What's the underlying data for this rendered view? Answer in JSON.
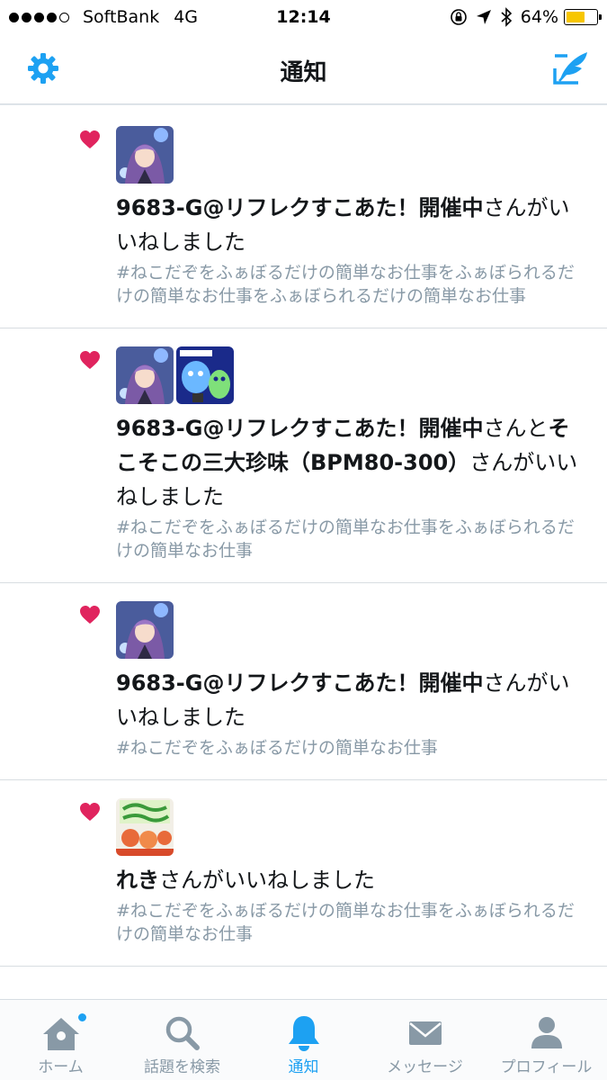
{
  "status_bar": {
    "carrier": "SoftBank",
    "network": "4G",
    "time": "12:14",
    "battery_percent": "64%",
    "battery_level": 0.64,
    "battery_color": "#f7c600"
  },
  "nav": {
    "title": "通知",
    "accent_color": "#1da1f2"
  },
  "notifications": [
    {
      "name": "9683-G@リフレクすこあた！開催中",
      "suffix": "さんがいいねしました",
      "tweet": "#ねこだぞをふぁぼるだけの簡単なお仕事をふぁぼられるだけの簡単なお仕事をふぁぼられるだけの簡単なお仕事"
    },
    {
      "name": "9683-G@リフレクすこあた！開催中",
      "joiner": "さんと",
      "name2": "そこそこの三大珍味（BPM80-300）",
      "suffix": "さんがいいねしました",
      "tweet": "#ねこだぞをふぁぼるだけの簡単なお仕事をふぁぼられるだけの簡単なお仕事"
    },
    {
      "name": "9683-G@リフレクすこあた！開催中",
      "suffix": "さんがいいねしました",
      "tweet": "#ねこだぞをふぁぼるだけの簡単なお仕事"
    },
    {
      "name": "れき",
      "suffix": "さんがいいねしました",
      "tweet": "#ねこだぞをふぁぼるだけの簡単なお仕事をふぁぼられるだけの簡単なお仕事"
    }
  ],
  "tabs": [
    {
      "label": "ホーム",
      "icon": "home-icon"
    },
    {
      "label": "話題を検索",
      "icon": "search-icon"
    },
    {
      "label": "通知",
      "icon": "bell-icon"
    },
    {
      "label": "メッセージ",
      "icon": "envelope-icon"
    },
    {
      "label": "プロフィール",
      "icon": "person-icon"
    }
  ]
}
